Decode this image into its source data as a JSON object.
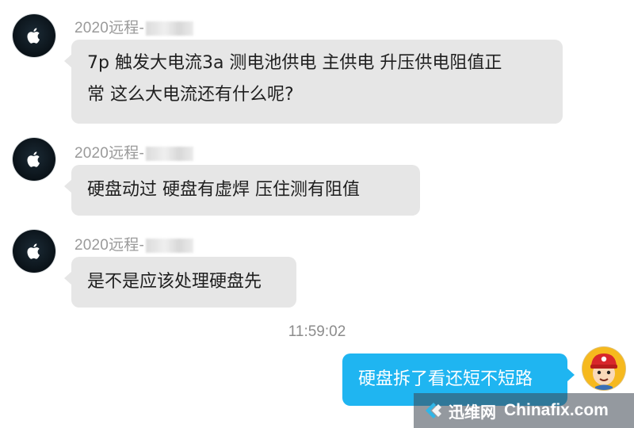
{
  "messages": [
    {
      "sender": "2020远程-",
      "text_line1": "7p 触发大电流3a  测电池供电 主供电 升压供电阻值正",
      "text_line2": "常  这么大电流还有什么呢?"
    },
    {
      "sender": "2020远程-",
      "text": "硬盘动过  硬盘有虚焊  压住测有阻值"
    },
    {
      "sender": "2020远程-",
      "text": "是不是应该处理硬盘先"
    }
  ],
  "timestamp": "11:59:02",
  "my_message": "硬盘拆了看还短不短路",
  "watermark": {
    "cn": "迅维网",
    "en": "Chinafix.com"
  },
  "icons": {
    "sender_avatar": "apple-logo-icon",
    "my_avatar": "cartoon-boy-avatar-icon",
    "watermark_logo": "chinafix-logo-icon"
  },
  "colors": {
    "incoming_bubble": "#e6e6e6",
    "outgoing_bubble": "#1fb5f1",
    "sender_text": "#9a9a9a"
  }
}
